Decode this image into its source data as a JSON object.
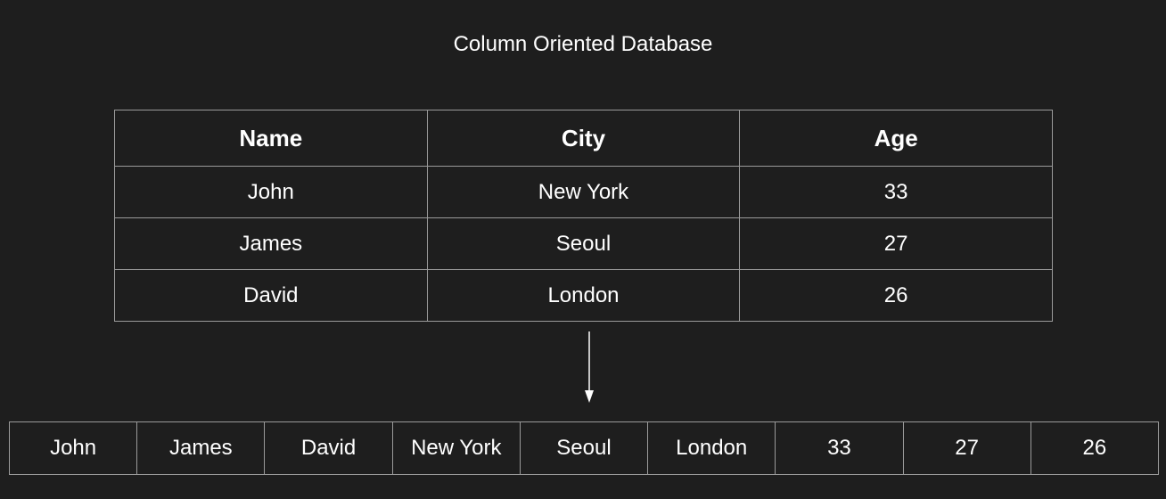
{
  "title": "Column Oriented Database",
  "table": {
    "headers": [
      "Name",
      "City",
      "Age"
    ],
    "rows": [
      [
        "John",
        "New York",
        "33"
      ],
      [
        "James",
        "Seoul",
        "27"
      ],
      [
        "David",
        "London",
        "26"
      ]
    ]
  },
  "column_store": [
    "John",
    "James",
    "David",
    "New York",
    "Seoul",
    "London",
    "33",
    "27",
    "26"
  ],
  "colors": {
    "background": "#1e1e1e",
    "text": "#ffffff",
    "border": "#9a9a9a"
  }
}
